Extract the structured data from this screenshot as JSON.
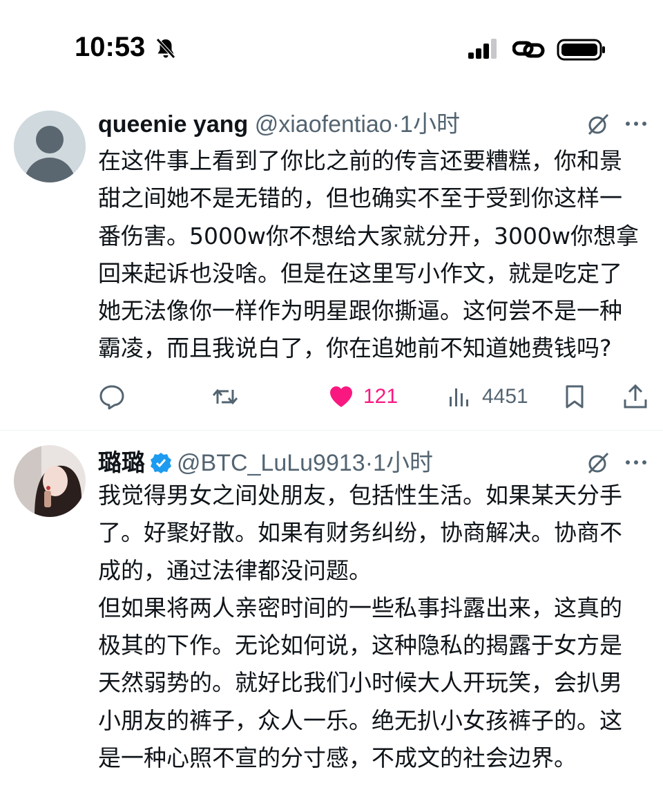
{
  "status_bar": {
    "time": "10:53"
  },
  "colors": {
    "like_pink": "#f91880",
    "secondary_text": "#536471",
    "verified_blue": "#1d9bf0"
  },
  "tweets": [
    {
      "display_name": "queenie yang",
      "handle": "@xiaofentiao",
      "separator": "·",
      "time": "1小时",
      "verified": false,
      "paragraphs": [
        "在这件事上看到了你比之前的传言还要糟糕，你和景甜之间她不是无错的，但也确实不至于受到你这样一番伤害。5000w你不想给大家就分开，3000w你想拿回来起诉也没啥。但是在这里写小作文，就是吃定了她无法像你一样作为明星跟你撕逼。这何尝不是一种霸凌，而且我说白了，你在追她前不知道她费钱吗?"
      ],
      "actions": {
        "likes": "121",
        "views": "4451"
      },
      "icons": [
        "avatar-default-icon",
        "grok-icon",
        "more-icon",
        "reply-icon",
        "retweet-icon",
        "like-icon",
        "views-icon",
        "bookmark-icon",
        "share-icon"
      ]
    },
    {
      "display_name": "璐璐",
      "handle": "@BTC_LuLu9913",
      "separator": "·",
      "time": "1小时",
      "verified": true,
      "paragraphs": [
        "我觉得男女之间处朋友，包括性生活。如果某天分手了。好聚好散。如果有财务纠纷，协商解决。协商不成的，通过法律都没问题。",
        "但如果将两人亲密时间的一些私事抖露出来，这真的极其的下作。无论如何说，这种隐私的揭露于女方是天然弱势的。就好比我们小时候大人开玩笑，会扒男小朋友的裤子，众人一乐。绝无扒小女孩裤子的。这是一种心照不宣的分寸感，不成文的社会边界。"
      ],
      "icons": [
        "avatar-photo",
        "verified-icon",
        "grok-icon",
        "more-icon"
      ]
    }
  ]
}
